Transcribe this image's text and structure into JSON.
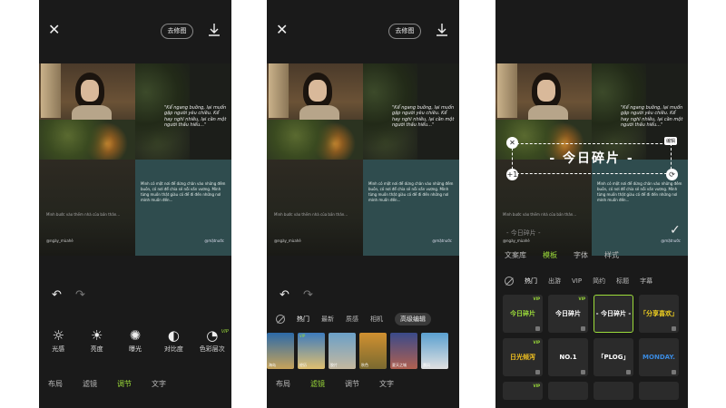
{
  "header": {
    "edit_button": "去修图"
  },
  "collage": {
    "quote_en": "\"Kể ngang buồng, lại muốn gặp người yêu chiều. Kể hay nghĩ nhiều, lại cần một người thấu hiểu...\"",
    "body_text": "Mình có một nơi để dừng chân vào những đêm buồn, có nơi để chia sẻ nỗi vấn vương. Mình từng muốn thật giàu có để đi đến những nơi mình muốn đến...",
    "shelf_text": "Mình bước vào thềm nhà của bản thân...",
    "sig_left": "@ngày_mùahè",
    "sig_right": "@mặtnước"
  },
  "panel1": {
    "tools": [
      {
        "icon": "sun-outline-icon",
        "glyph": "☼",
        "label": "光感",
        "vip": ""
      },
      {
        "icon": "brightness-icon",
        "glyph": "☀",
        "label": "亮度",
        "vip": ""
      },
      {
        "icon": "exposure-icon",
        "glyph": "✺",
        "label": "曝光",
        "vip": ""
      },
      {
        "icon": "contrast-icon",
        "glyph": "◐",
        "label": "对比度",
        "vip": ""
      },
      {
        "icon": "color-layers-icon",
        "glyph": "◔",
        "label": "色彩层次",
        "vip": "VIP"
      }
    ],
    "tabs": [
      "布局",
      "滤镜",
      "调节",
      "文字"
    ],
    "active_tab": "调节"
  },
  "panel2": {
    "filter_cats": [
      "热门",
      "最新",
      "质感",
      "相机"
    ],
    "advanced": "高级编辑",
    "thumbs": [
      {
        "label": "海岛",
        "c1": "#2c6aa8",
        "c2": "#c7a35a",
        "vip": ""
      },
      {
        "label": "经历",
        "c1": "#3d7bbd",
        "c2": "#e0c070",
        "vip": "VIP"
      },
      {
        "label": "胶片",
        "c1": "#6ba0c8",
        "c2": "#c5b8a0",
        "vip": ""
      },
      {
        "label": "秋色",
        "c1": "#d09030",
        "c2": "#7a6a30",
        "vip": ""
      },
      {
        "label": "夏天之城",
        "c1": "#3a4a8a",
        "c2": "#b06050",
        "vip": ""
      },
      {
        "label": "晨风",
        "c1": "#5aa0d0",
        "c2": "#e0e0e0",
        "vip": ""
      }
    ],
    "tabs": [
      "布局",
      "滤镜",
      "调节",
      "文字"
    ],
    "active_tab": "滤镜"
  },
  "panel3": {
    "text_overlay": "- 今日碎片 -",
    "edit_tag": "编辑",
    "top_label": "- 今日碎片 -",
    "text_tabs": [
      "文案库",
      "模板",
      "字体",
      "样式"
    ],
    "active_text_tab": "模板",
    "categories": [
      "热门",
      "出游",
      "VIP",
      "简约",
      "标题",
      "字幕"
    ],
    "templates": [
      {
        "text": "今日碎片",
        "vip": "VIP",
        "color": "#9cdc3a",
        "sel": false
      },
      {
        "text": "今日碎片",
        "vip": "VIP",
        "color": "#ffffff",
        "sel": false
      },
      {
        "text": "- 今日碎片 -",
        "vip": "",
        "color": "#ffffff",
        "sel": true
      },
      {
        "text": "「分享喜欢」",
        "vip": "",
        "color": "#f0d020",
        "sel": false
      },
      {
        "text": "日光倾泻",
        "vip": "VIP",
        "color": "#f0c020",
        "sel": false
      },
      {
        "text": "NO.1",
        "vip": "",
        "color": "#ffffff",
        "sel": false
      },
      {
        "text": "「PLOG」",
        "vip": "",
        "color": "#ffffff",
        "sel": false
      },
      {
        "text": "MONDAY.",
        "vip": "",
        "color": "#3a8ae0",
        "sel": false
      },
      {
        "text": "",
        "vip": "VIP",
        "color": "#ffffff",
        "sel": false
      },
      {
        "text": "",
        "vip": "",
        "color": "#ffffff",
        "sel": false
      },
      {
        "text": "",
        "vip": "",
        "color": "#ffffff",
        "sel": false
      },
      {
        "text": "",
        "vip": "",
        "color": "#ffffff",
        "sel": false
      }
    ]
  },
  "colors": {
    "accent": "#9cdc3a",
    "bg": "#1a1a1a"
  }
}
